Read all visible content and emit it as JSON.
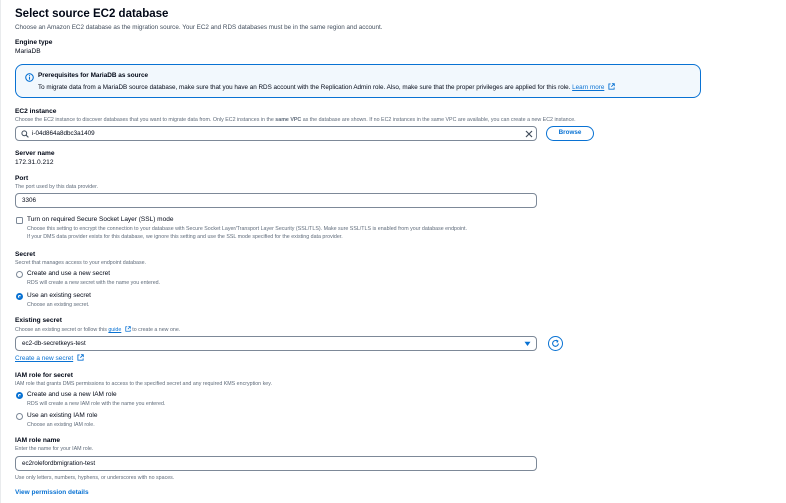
{
  "header": {
    "title": "Select source EC2 database",
    "description": "Choose an Amazon EC2 database as the migration source. Your EC2 and RDS databases must be in the same region and account."
  },
  "engine": {
    "label": "Engine type",
    "value": "MariaDB"
  },
  "alert": {
    "icon": "info-icon",
    "title": "Prerequisites for MariaDB as source",
    "body": "To migrate data from a MariaDB source database, make sure that you have an RDS account with the Replication Admin role. Also, make sure that the proper privileges are applied for this role.",
    "link": "Learn more"
  },
  "ec2_instance": {
    "label": "EC2 instance",
    "desc_prefix": "Choose the EC2 instance to discover databases that you want to migrate data from. Only EC2 instances in the",
    "desc_bold": "same VPC",
    "desc_suffix": "as the database are shown. If no EC2 instances in the same VPC are available, you can create a new EC2 instance.",
    "value": "i-04d864a8dbc3a1409",
    "browse": "Browse"
  },
  "server": {
    "label": "Server name",
    "value": "172.31.0.212"
  },
  "port": {
    "label": "Port",
    "desc": "The port used by this data provider.",
    "value": "3306"
  },
  "ssl": {
    "label": "Turn on required Secure Socket Layer (SSL) mode",
    "desc1": "Choose this setting to encrypt the connection to your database with Secure Socket Layer/Transport Layer Security (SSL/TLS). Make sure SSL/TLS is enabled from your database endpoint.",
    "desc2": "If your DMS data provider exists for this database, we ignore this setting and use the SSL mode specified for the existing data provider."
  },
  "secret": {
    "label": "Secret",
    "desc": "Secret that manages access to your endpoint database.",
    "opt1": "Create and use a new secret",
    "opt1_desc": "RDS will create a new secret with the name you entered.",
    "opt2": "Use an existing secret",
    "opt2_desc": "Choose an existing secret."
  },
  "existing_secret": {
    "label": "Existing secret",
    "desc_prefix": "Choose an existing secret or follow this",
    "desc_link": "guide",
    "desc_suffix": "to create a new one.",
    "value": "ec2-db-secretkeys-test",
    "create_link": "Create a new secret"
  },
  "iam_role_secret": {
    "label": "IAM role for secret",
    "desc": "IAM role that grants DMS permissions to access to the specified secret and any required KMS encryption key.",
    "opt1": "Create and use a new IAM role",
    "opt1_desc": "RDS will create a new IAM role with the name you entered.",
    "opt2": "Use an existing IAM role",
    "opt2_desc": "Choose an existing IAM role."
  },
  "iam_role_name": {
    "label": "IAM role name",
    "desc": "Enter the name for your IAM role.",
    "value": "ec2rolefordbmigration-test",
    "hint": "Use only letters, numbers, hyphens, or underscores with no spaces."
  },
  "footer": {
    "link": "View permission details"
  },
  "colors": {
    "accent": "#0972d3",
    "alert_bg": "#f2f8fd",
    "text": "#000716",
    "muted": "#5f6b7a"
  }
}
